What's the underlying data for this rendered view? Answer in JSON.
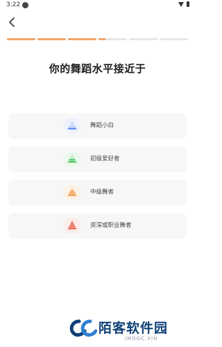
{
  "status": {
    "time": "3:22"
  },
  "progress": [
    1,
    1,
    1,
    0.25,
    0,
    0
  ],
  "title": "你的舞蹈水平接近于",
  "options": [
    {
      "label": "舞蹈小白",
      "icon": "beginner-pyramid-icon",
      "color": "#6a8ff0",
      "bg": "#eef2fc",
      "levels": 1
    },
    {
      "label": "初级爱好者",
      "icon": "hobbyist-pyramid-icon",
      "color": "#5ccb6c",
      "bg": "#ecf8ee",
      "levels": 2
    },
    {
      "label": "中级舞者",
      "icon": "intermediate-pyramid-icon",
      "color": "#f0a65c",
      "bg": "#fcf2e8",
      "levels": 3
    },
    {
      "label": "资深或职业舞者",
      "icon": "advanced-pyramid-icon",
      "color": "#ee6d5f",
      "bg": "#fcedeb",
      "levels": 4
    }
  ],
  "watermark": {
    "title": "陌客软件园",
    "subtitle": "IMOOC.XIN",
    "color": "#0e3f76"
  }
}
